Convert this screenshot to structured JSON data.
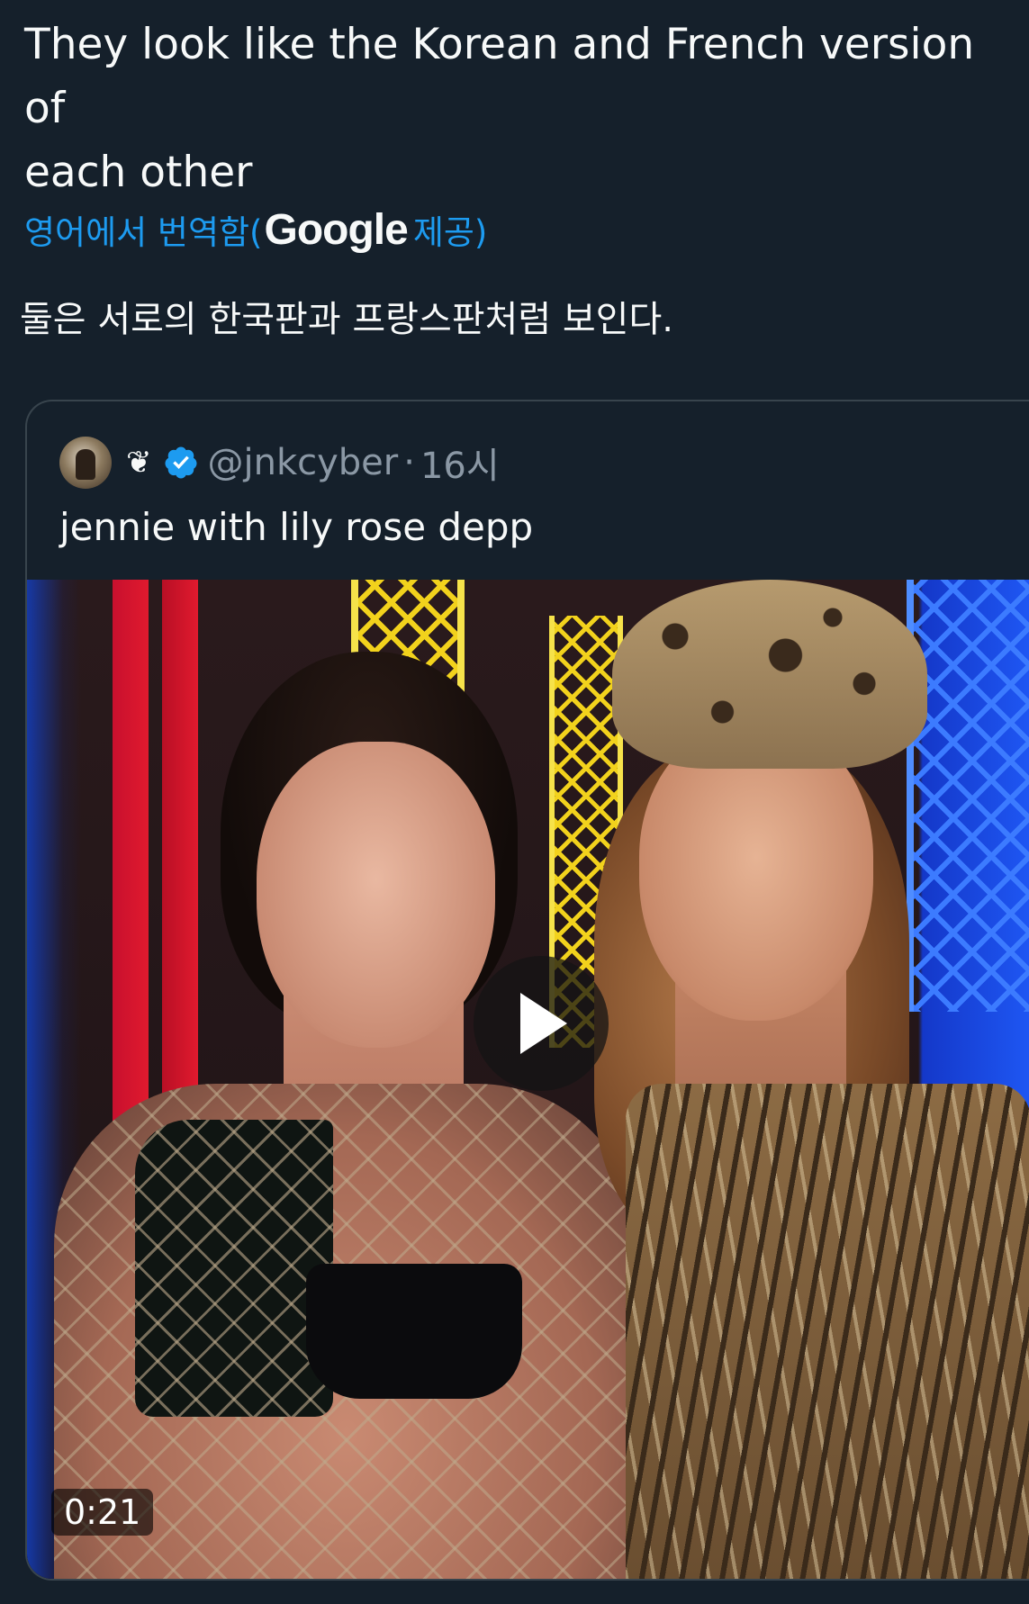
{
  "tweet": {
    "text_line1": "They look like the Korean and French version of",
    "text_line2": "each other"
  },
  "translation": {
    "prefix": "영어에서 번역함(",
    "provider": "Google",
    "suffix": " 제공)",
    "translated_text": "둘은 서로의 한국판과 프랑스판처럼 보인다."
  },
  "quote": {
    "emoji": "❦",
    "handle": "@jnkcyber",
    "separator": "·",
    "time": "16시",
    "text": "jennie with lily rose depp",
    "video": {
      "duration": "0:21"
    }
  },
  "colors": {
    "background": "#15202b",
    "link": "#1d9bf0",
    "verified": "#1d9bf0",
    "muted": "#8b98a5"
  }
}
